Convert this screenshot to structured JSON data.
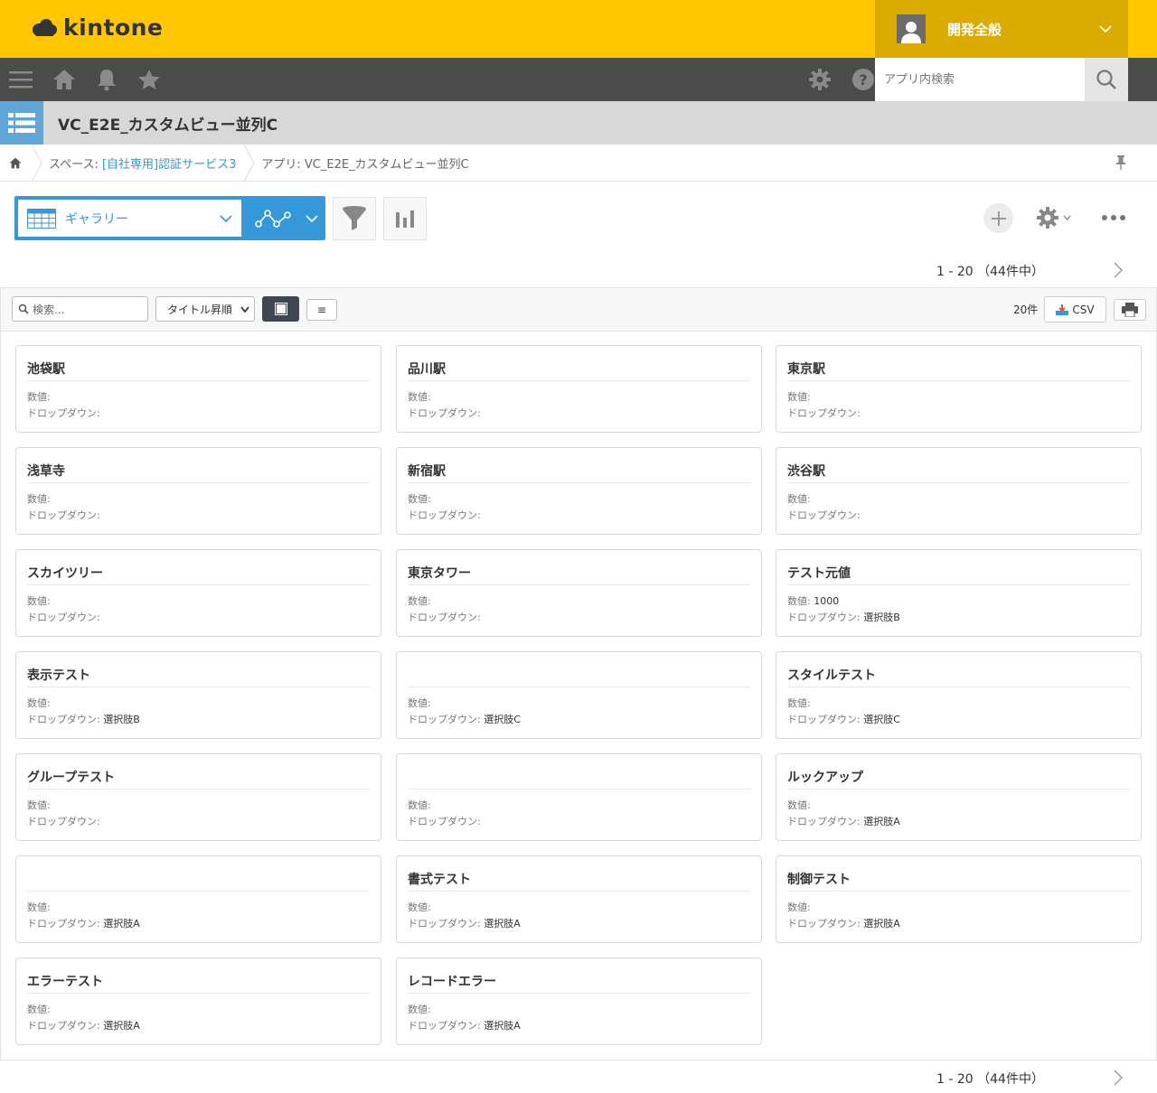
{
  "header": {
    "brand": "kintone",
    "user_name": "開発全般"
  },
  "search": {
    "placeholder": "アプリ内検索"
  },
  "app": {
    "title": "VC_E2E_カスタムビュー並列C"
  },
  "breadcrumb": {
    "space_prefix": "スペース: ",
    "space_link": "[自社専用]認証サービス3",
    "app_crumb": "アプリ: VC_E2E_カスタムビュー並列C"
  },
  "view": {
    "selected": "ギャラリー"
  },
  "pager": {
    "range": "1 - 20 （44件中）"
  },
  "gallery": {
    "search_placeholder": "検索...",
    "sort_label": "タイトル昇順",
    "list_toggle": "≡",
    "per_page": "20件",
    "csv_label": "CSV",
    "cards": [
      {
        "title": "池袋駅",
        "f1_label": "数値:",
        "f1_value": "",
        "f2_label": "ドロップダウン:",
        "f2_value": ""
      },
      {
        "title": "品川駅",
        "f1_label": "数値:",
        "f1_value": "",
        "f2_label": "ドロップダウン:",
        "f2_value": ""
      },
      {
        "title": "東京駅",
        "f1_label": "数値:",
        "f1_value": "",
        "f2_label": "ドロップダウン:",
        "f2_value": ""
      },
      {
        "title": "浅草寺",
        "f1_label": "数値:",
        "f1_value": "",
        "f2_label": "ドロップダウン:",
        "f2_value": ""
      },
      {
        "title": "新宿駅",
        "f1_label": "数値:",
        "f1_value": "",
        "f2_label": "ドロップダウン:",
        "f2_value": ""
      },
      {
        "title": "渋谷駅",
        "f1_label": "数値:",
        "f1_value": "",
        "f2_label": "ドロップダウン:",
        "f2_value": ""
      },
      {
        "title": "スカイツリー",
        "f1_label": "数値:",
        "f1_value": "",
        "f2_label": "ドロップダウン:",
        "f2_value": ""
      },
      {
        "title": "東京タワー",
        "f1_label": "数値:",
        "f1_value": "",
        "f2_label": "ドロップダウン:",
        "f2_value": ""
      },
      {
        "title": "テスト元値",
        "f1_label": "数値:",
        "f1_value": "1000",
        "f2_label": "ドロップダウン:",
        "f2_value": "選択肢B"
      },
      {
        "title": "表示テスト",
        "f1_label": "数値:",
        "f1_value": "",
        "f2_label": "ドロップダウン:",
        "f2_value": "選択肢B"
      },
      {
        "title": "",
        "f1_label": "数値:",
        "f1_value": "",
        "f2_label": "ドロップダウン:",
        "f2_value": "選択肢C"
      },
      {
        "title": "スタイルテスト",
        "f1_label": "数値:",
        "f1_value": "",
        "f2_label": "ドロップダウン:",
        "f2_value": "選択肢C"
      },
      {
        "title": "グループテスト",
        "f1_label": "数値:",
        "f1_value": "",
        "f2_label": "ドロップダウン:",
        "f2_value": ""
      },
      {
        "title": "",
        "f1_label": "数値:",
        "f1_value": "",
        "f2_label": "ドロップダウン:",
        "f2_value": ""
      },
      {
        "title": "ルックアップ",
        "f1_label": "数値:",
        "f1_value": "",
        "f2_label": "ドロップダウン:",
        "f2_value": "選択肢A"
      },
      {
        "title": "",
        "f1_label": "数値:",
        "f1_value": "",
        "f2_label": "ドロップダウン:",
        "f2_value": "選択肢A"
      },
      {
        "title": "書式テスト",
        "f1_label": "数値:",
        "f1_value": "",
        "f2_label": "ドロップダウン:",
        "f2_value": "選択肢A"
      },
      {
        "title": "制御テスト",
        "f1_label": "数値:",
        "f1_value": "",
        "f2_label": "ドロップダウン:",
        "f2_value": "選択肢A"
      },
      {
        "title": "エラーテスト",
        "f1_label": "数値:",
        "f1_value": "",
        "f2_label": "ドロップダウン:",
        "f2_value": "選択肢A"
      },
      {
        "title": "レコードエラー",
        "f1_label": "数値:",
        "f1_value": "",
        "f2_label": "ドロップダウン:",
        "f2_value": "選択肢A"
      }
    ]
  },
  "colors": {
    "topbar": "#ffc700",
    "user_box": "#dcab00",
    "navbar": "#4b4b4b",
    "accent": "#3498db"
  },
  "icons": [
    "cloud-logo-icon",
    "user-icon",
    "chevron-down-icon",
    "menu-icon",
    "home-icon",
    "bell-icon",
    "star-icon",
    "gear-icon",
    "help-icon",
    "search-icon",
    "app-list-icon",
    "pin-icon",
    "table-icon",
    "graph-icon",
    "filter-icon",
    "bar-chart-icon",
    "plus-icon",
    "more-icon",
    "chevron-right-icon",
    "print-icon",
    "download-icon"
  ]
}
